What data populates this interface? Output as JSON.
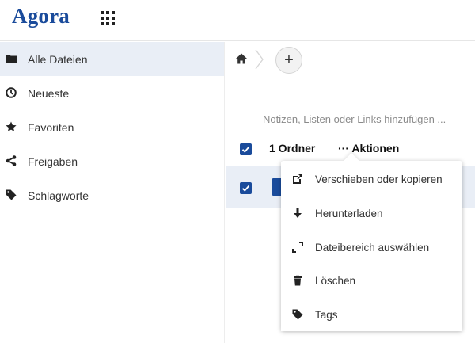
{
  "header": {
    "logo_text": "Agora",
    "apps_icon": "apps-grid-icon"
  },
  "sidebar": {
    "items": [
      {
        "label": "Alle Dateien",
        "icon": "folder-icon",
        "active": true
      },
      {
        "label": "Neueste",
        "icon": "clock-icon",
        "active": false
      },
      {
        "label": "Favoriten",
        "icon": "star-icon",
        "active": false
      },
      {
        "label": "Freigaben",
        "icon": "share-icon",
        "active": false
      },
      {
        "label": "Schlagworte",
        "icon": "tag-icon",
        "active": false
      }
    ]
  },
  "breadcrumb": {
    "home_icon": "home-icon",
    "add_label": "+"
  },
  "notes": {
    "placeholder": "Notizen, Listen oder Links hinzufügen ..."
  },
  "selection": {
    "count_label": "1 Ordner",
    "actions_label": "··· Aktionen",
    "checked": true
  },
  "file_row": {
    "checked": true
  },
  "actions_menu": {
    "items": [
      {
        "label": "Verschieben oder kopieren",
        "icon": "external-link-icon"
      },
      {
        "label": "Herunterladen",
        "icon": "download-icon"
      },
      {
        "label": "Dateibereich auswählen",
        "icon": "select-range-icon"
      },
      {
        "label": "Löschen",
        "icon": "trash-icon"
      },
      {
        "label": "Tags",
        "icon": "tag-icon"
      }
    ]
  },
  "colors": {
    "brand": "#1a4b9b",
    "active_bg": "#e9eef6",
    "muted_text": "#8a8a8a"
  }
}
